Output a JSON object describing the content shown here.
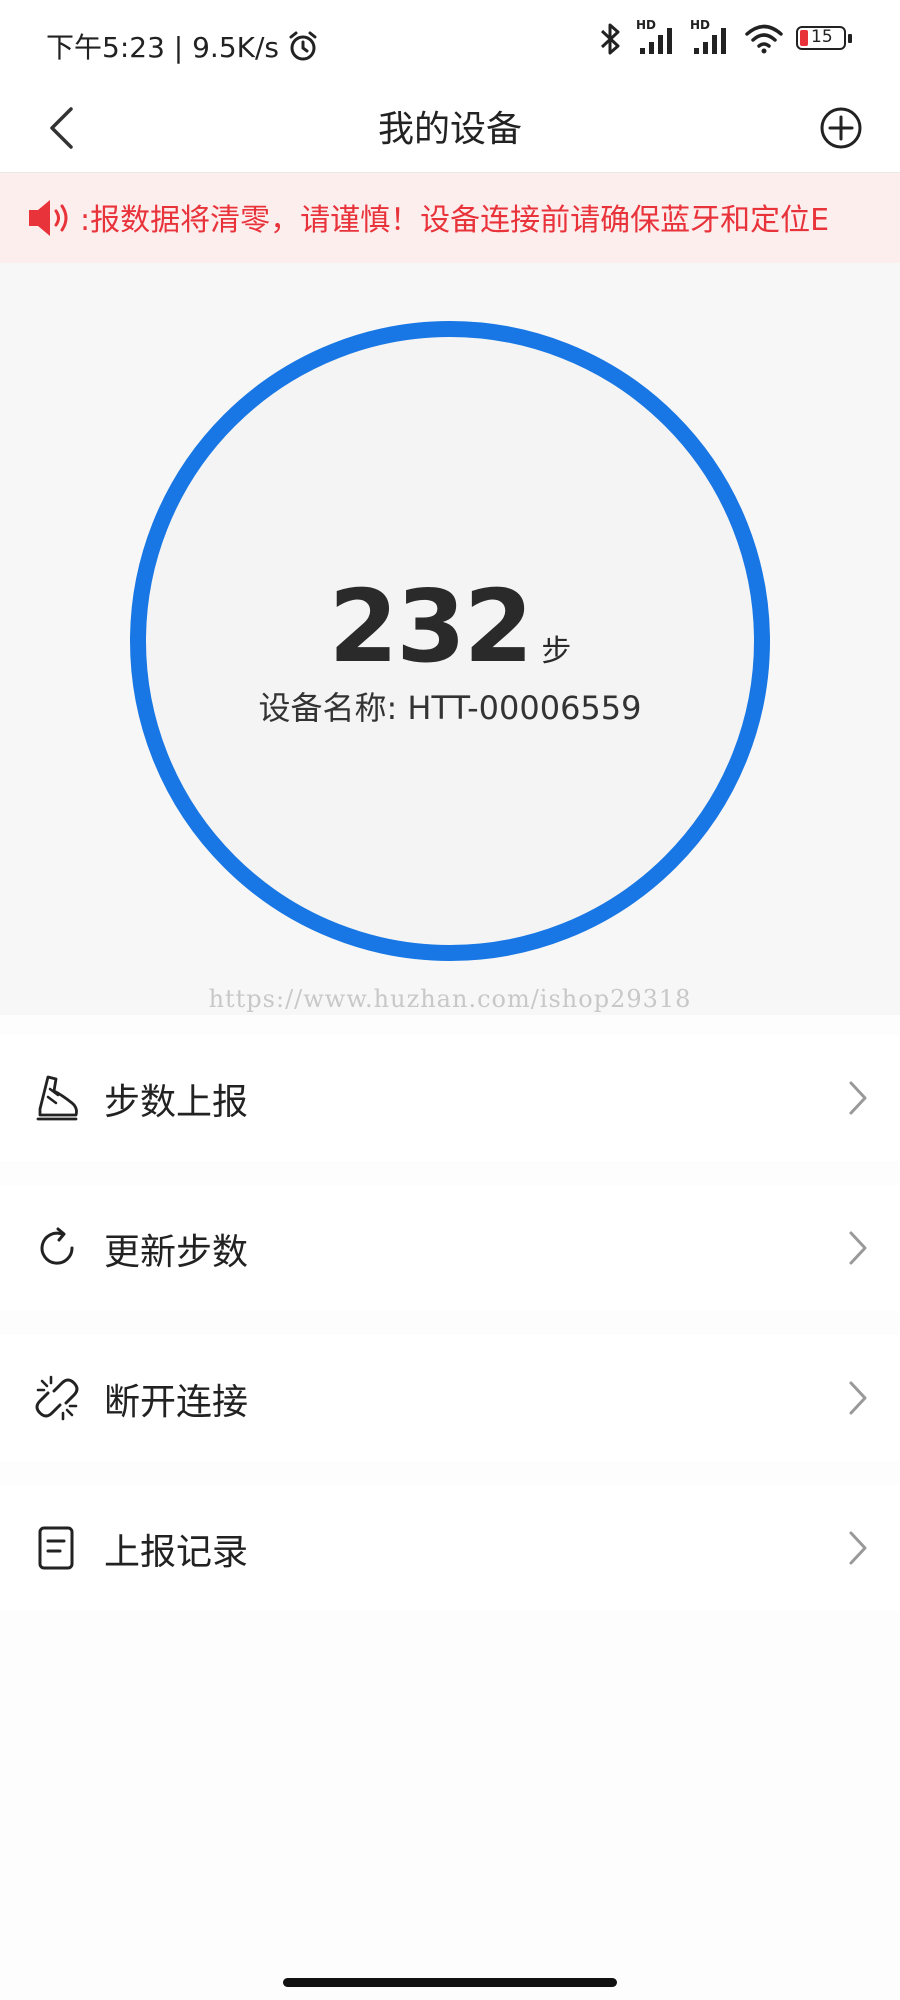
{
  "status_bar": {
    "time_speed": "下午5:23 | 9.5K/s",
    "hd_label_1": "HD",
    "hd_label_2": "HD",
    "battery": "15"
  },
  "nav": {
    "title": "我的设备"
  },
  "notice": {
    "text": ":报数据将清零，请谨慎！设备连接前请确保蓝牙和定位E"
  },
  "device": {
    "steps": "232",
    "steps_unit": "步",
    "name_text": "设备名称: HTT-00006559"
  },
  "watermark": "https://www.huzhan.com/ishop29318",
  "menu": {
    "items": [
      {
        "label": "步数上报",
        "icon": "shoe-icon"
      },
      {
        "label": "更新步数",
        "icon": "refresh-icon"
      },
      {
        "label": "断开连接",
        "icon": "broken-link-icon"
      },
      {
        "label": "上报记录",
        "icon": "document-icon"
      }
    ]
  },
  "colors": {
    "ring": "#1877e4",
    "notice_text": "#e8333b",
    "notice_bg": "#fdeeee"
  }
}
